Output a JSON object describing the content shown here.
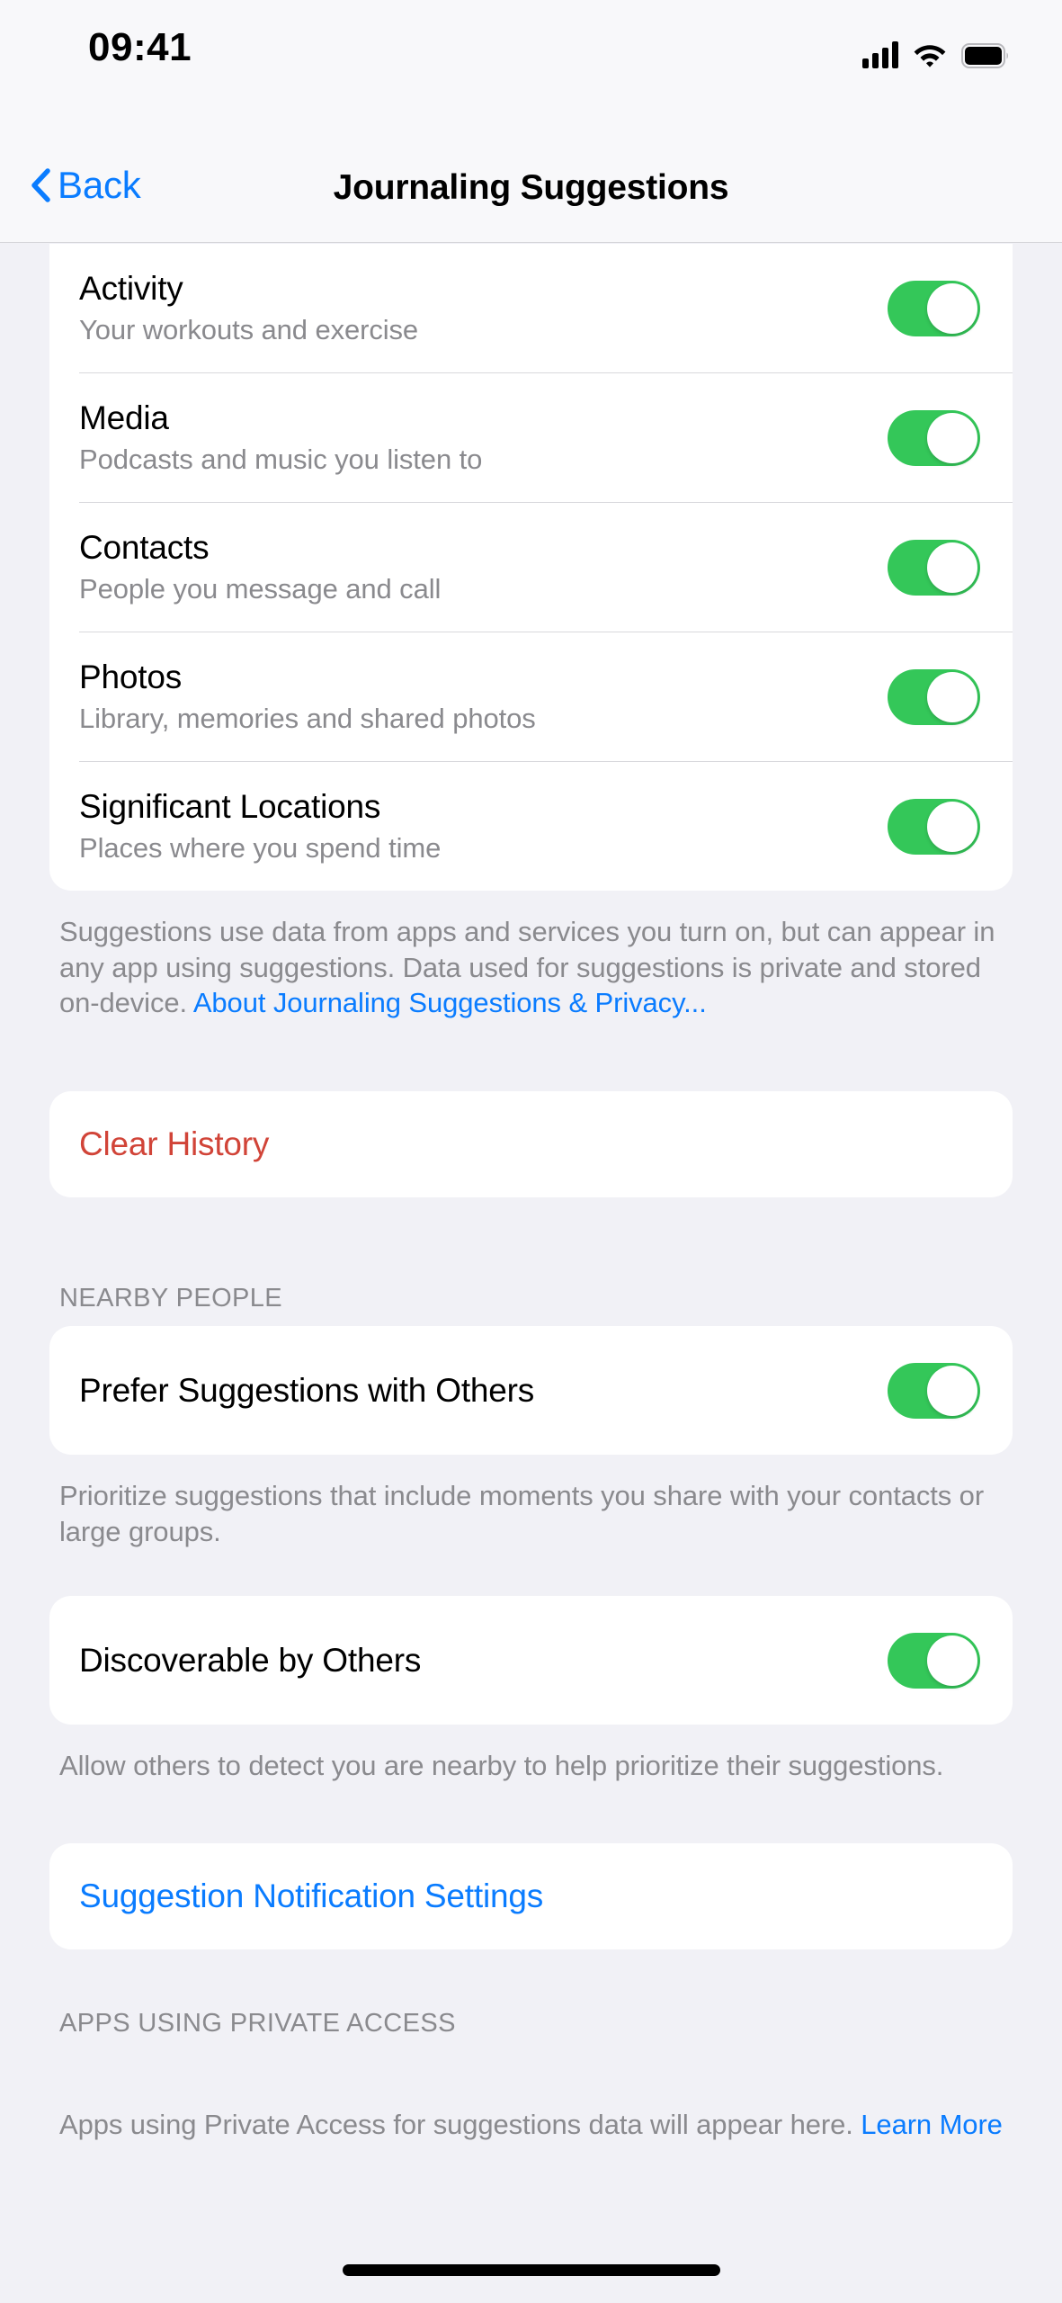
{
  "status_bar": {
    "time": "09:41",
    "cellular_icon": "cellular-signal-icon",
    "wifi_icon": "wifi-icon",
    "battery_icon": "battery-full-icon"
  },
  "nav_bar": {
    "back_label": "Back",
    "back_icon": "chevron-left-icon",
    "title": "Journaling Suggestions"
  },
  "colors": {
    "accent_blue": "#0a7cff",
    "destructive_red": "#d14438",
    "toggle_on_green": "#34c759",
    "background": "#f1f1f6",
    "card": "#ffffff",
    "secondary_text": "#8a8a8e"
  },
  "suggestions_section": {
    "rows": [
      {
        "title": "Activity",
        "subtitle": "Your workouts and exercise",
        "toggle": "on"
      },
      {
        "title": "Media",
        "subtitle": "Podcasts and music you listen to",
        "toggle": "on"
      },
      {
        "title": "Contacts",
        "subtitle": "People you message and call",
        "toggle": "on"
      },
      {
        "title": "Photos",
        "subtitle": "Library, memories and shared photos",
        "toggle": "on"
      },
      {
        "title": "Significant Locations",
        "subtitle": "Places where you spend time",
        "toggle": "on"
      }
    ],
    "footer_text": "Suggestions use data from apps and services you turn on, but can appear in any app using suggestions. Data used for suggestions is private and stored on-device. ",
    "footer_link": "About Journaling Suggestions & Privacy..."
  },
  "clear_history_section": {
    "label": "Clear History"
  },
  "nearby_people_section": {
    "header": "NEARBY PEOPLE",
    "prefer_row": {
      "title": "Prefer Suggestions with Others",
      "toggle": "on"
    },
    "prefer_footer": "Prioritize suggestions that include moments you share with your contacts or large groups.",
    "discoverable_row": {
      "title": "Discoverable by Others",
      "toggle": "on"
    },
    "discoverable_footer": "Allow others to detect you are nearby to help prioritize their suggestions."
  },
  "notification_settings_section": {
    "label": "Suggestion Notification Settings"
  },
  "private_access_section": {
    "header": "APPS USING PRIVATE ACCESS",
    "footer_text": "Apps using Private Access for suggestions data will appear here. ",
    "footer_link": "Learn More"
  },
  "home_indicator": "home-indicator"
}
